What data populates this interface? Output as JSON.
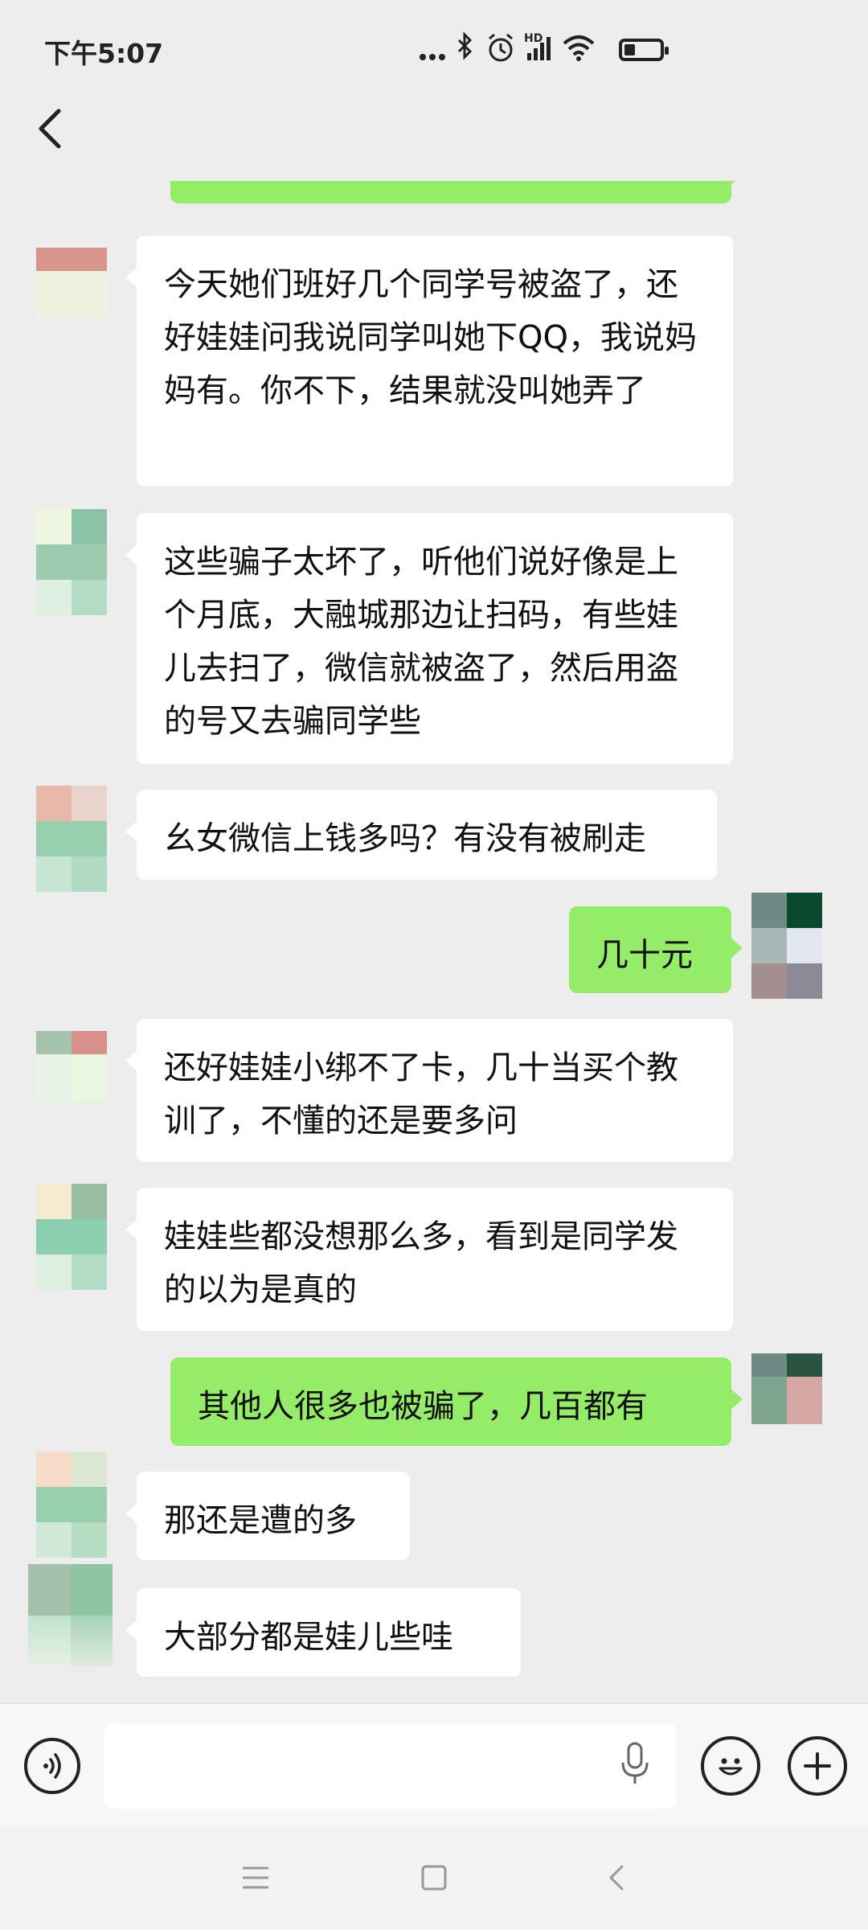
{
  "status_bar": {
    "time": "下午5:07",
    "hd_label": "HD",
    "battery_level": 0.3
  },
  "header": {
    "back_icon": "chevron-left-icon"
  },
  "messages": [
    {
      "side": "sent",
      "text": "",
      "partial": true
    },
    {
      "side": "recv",
      "text": "今天她们班好几个同学号被盗了，还好娃娃问我说同学叫她下QQ，我说妈妈有。你不下，结果就没叫她弄了"
    },
    {
      "side": "recv",
      "text": "这些骗子太坏了，听他们说好像是上个月底，大融城那边让扫码，有些娃儿去扫了，微信就被盗了，然后用盗的号又去骗同学些"
    },
    {
      "side": "recv",
      "text": "幺女微信上钱多吗？有没有被刷走"
    },
    {
      "side": "sent",
      "text": "几十元"
    },
    {
      "side": "recv",
      "text": "还好娃娃小绑不了卡，几十当买个教训了，不懂的还是要多问"
    },
    {
      "side": "recv",
      "text": "娃娃些都没想那么多，看到是同学发的以为是真的"
    },
    {
      "side": "sent",
      "text": "其他人很多也被骗了，几百都有"
    },
    {
      "side": "recv",
      "text": "那还是遭的多"
    },
    {
      "side": "recv",
      "text": "大部分都是娃儿些哇"
    }
  ],
  "input_bar": {
    "voice_icon": "voice-icon",
    "placeholder": "",
    "mic_icon": "microphone-icon",
    "emoji_icon": "emoji-icon",
    "plus_icon": "plus-icon"
  },
  "nav_bar": {
    "menu_icon": "menu-icon",
    "home_icon": "home-icon",
    "back_icon": "back-triangle-icon"
  },
  "colors": {
    "background": "#ededed",
    "sent_bubble": "#95ec69",
    "recv_bubble": "#ffffff"
  }
}
